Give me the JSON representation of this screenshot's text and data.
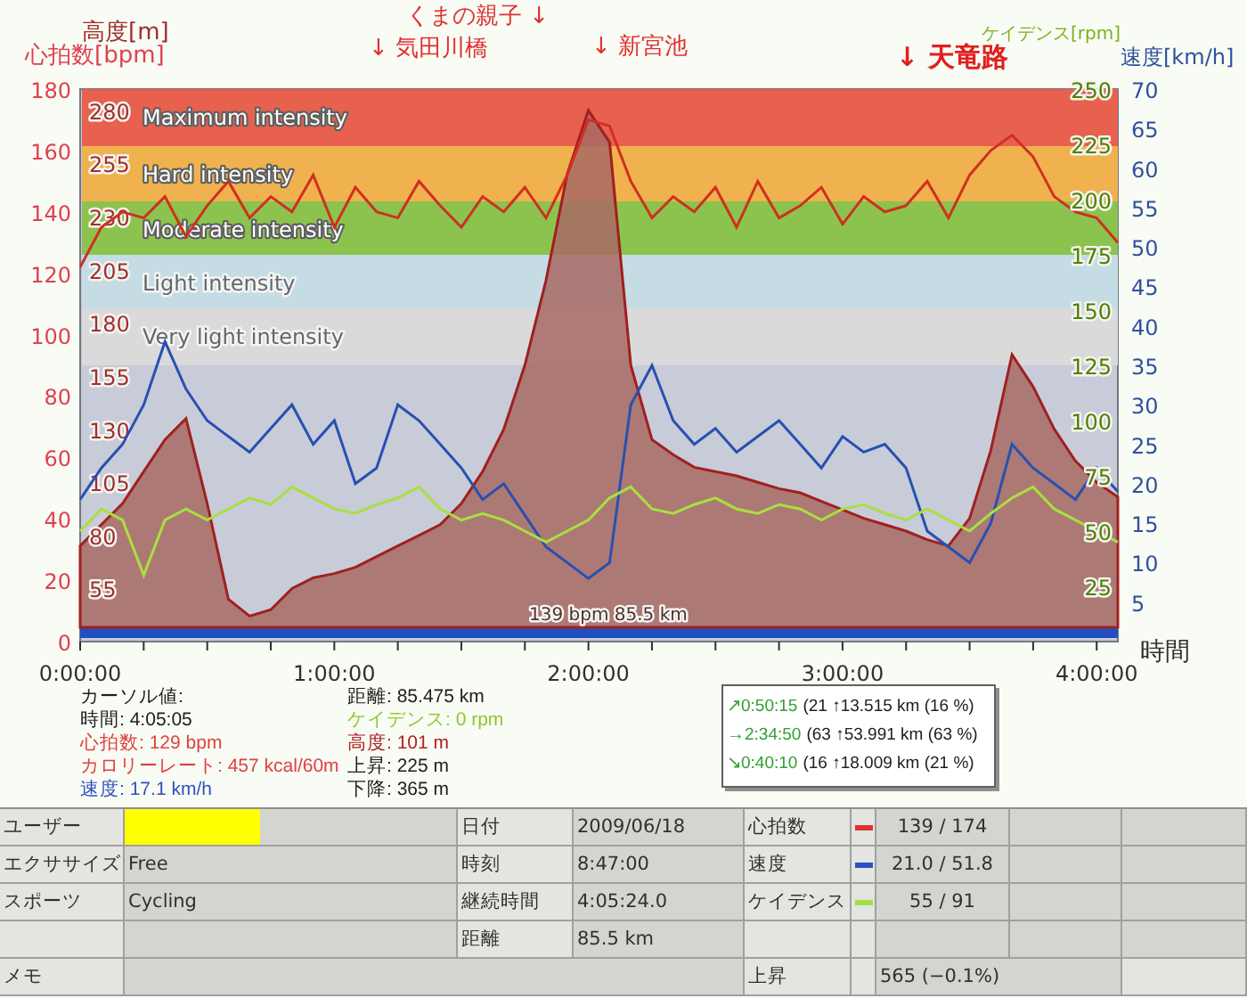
{
  "chart": {
    "markers": [
      {
        "label": "くまの親子 ↓",
        "kind": "normal"
      },
      {
        "label": "↓ 気田川橋",
        "kind": "normal"
      },
      {
        "label": "↓ 新宮池",
        "kind": "normal"
      },
      {
        "label": "↓ 天竜路",
        "kind": "bold"
      }
    ],
    "zones": [
      {
        "label": "Maximum intensity",
        "color": "#e8604e"
      },
      {
        "label": "Hard intensity",
        "color": "#f0b24e"
      },
      {
        "label": "Moderate intensity",
        "color": "#8cc34e"
      },
      {
        "label": "Light intensity",
        "color": "#c6dce4"
      },
      {
        "label": "Very light intensity",
        "color": "#dadada"
      }
    ],
    "readout": "139 bpm 85.5 km",
    "layers": [
      {
        "kind": "altitude",
        "chart_data": {
          "type": "area",
          "ylabel": "高度[m]",
          "xlim": [
            0,
            245
          ],
          "ylim": [
            30,
            290
          ],
          "yticks": [
            280,
            255,
            230,
            205,
            180,
            155,
            130,
            105,
            80,
            55
          ],
          "x": [
            0,
            5,
            10,
            15,
            20,
            25,
            30,
            35,
            40,
            45,
            50,
            55,
            60,
            65,
            70,
            75,
            80,
            85,
            90,
            95,
            100,
            105,
            110,
            115,
            120,
            125,
            130,
            135,
            140,
            145,
            150,
            155,
            160,
            165,
            170,
            175,
            180,
            185,
            190,
            195,
            200,
            205,
            210,
            215,
            220,
            225,
            230,
            235,
            240,
            245
          ],
          "values": [
            75,
            85,
            95,
            110,
            125,
            135,
            95,
            50,
            42,
            45,
            55,
            60,
            62,
            65,
            70,
            75,
            80,
            85,
            95,
            110,
            130,
            160,
            200,
            250,
            280,
            265,
            160,
            125,
            118,
            112,
            110,
            108,
            105,
            102,
            100,
            96,
            92,
            88,
            85,
            82,
            78,
            75,
            88,
            120,
            165,
            150,
            130,
            115,
            105,
            98
          ]
        }
      },
      {
        "kind": "speed",
        "chart_data": {
          "type": "line",
          "ylabel": "速度[km/h]",
          "xlim": [
            0,
            245
          ],
          "ylim": [
            0,
            70
          ],
          "yticks": [
            70,
            65,
            60,
            55,
            50,
            45,
            40,
            35,
            30,
            25,
            20,
            15,
            10,
            5
          ],
          "x": [
            0,
            5,
            10,
            15,
            20,
            25,
            30,
            35,
            40,
            45,
            50,
            55,
            60,
            65,
            70,
            75,
            80,
            85,
            90,
            95,
            100,
            105,
            110,
            115,
            120,
            125,
            130,
            135,
            140,
            145,
            150,
            155,
            160,
            165,
            170,
            175,
            180,
            185,
            190,
            195,
            200,
            205,
            210,
            215,
            220,
            225,
            230,
            235,
            240,
            245
          ],
          "values": [
            18,
            22,
            25,
            30,
            38,
            32,
            28,
            26,
            24,
            27,
            30,
            25,
            28,
            20,
            22,
            30,
            28,
            25,
            22,
            18,
            20,
            16,
            12,
            10,
            8,
            10,
            30,
            35,
            28,
            25,
            27,
            24,
            26,
            28,
            25,
            22,
            26,
            24,
            25,
            22,
            14,
            12,
            10,
            15,
            25,
            22,
            20,
            18,
            22,
            19
          ]
        }
      },
      {
        "kind": "heart_rate",
        "chart_data": {
          "type": "line",
          "xlabel": "時間",
          "ylabel": "心拍数[bpm]",
          "xlim": [
            0,
            245
          ],
          "ylim": [
            0,
            180
          ],
          "yticks": [
            180,
            160,
            140,
            120,
            100,
            80,
            60,
            40,
            20,
            0
          ],
          "xticks": [
            {
              "value": 0,
              "label": "0:00:00"
            },
            {
              "value": 60,
              "label": "1:00:00"
            },
            {
              "value": 120,
              "label": "2:00:00"
            },
            {
              "value": 180,
              "label": "3:00:00"
            },
            {
              "value": 240,
              "label": "4:00:00"
            }
          ],
          "x": [
            0,
            5,
            10,
            15,
            20,
            25,
            30,
            35,
            40,
            45,
            50,
            55,
            60,
            65,
            70,
            75,
            80,
            85,
            90,
            95,
            100,
            105,
            110,
            115,
            120,
            125,
            130,
            135,
            140,
            145,
            150,
            155,
            160,
            165,
            170,
            175,
            180,
            185,
            190,
            195,
            200,
            205,
            210,
            215,
            220,
            225,
            230,
            235,
            240,
            245
          ],
          "values": [
            122,
            135,
            140,
            138,
            145,
            132,
            142,
            150,
            138,
            145,
            140,
            152,
            135,
            148,
            140,
            138,
            150,
            142,
            135,
            145,
            140,
            148,
            138,
            152,
            170,
            168,
            150,
            138,
            145,
            140,
            148,
            135,
            150,
            138,
            142,
            148,
            136,
            145,
            140,
            142,
            150,
            138,
            152,
            160,
            165,
            158,
            145,
            140,
            138,
            130
          ]
        }
      },
      {
        "kind": "cadence",
        "chart_data": {
          "type": "line",
          "ylabel": "ケイデンス[rpm]",
          "xlim": [
            0,
            245
          ],
          "ylim": [
            0,
            250
          ],
          "yticks": [
            250,
            225,
            200,
            175,
            150,
            125,
            100,
            75,
            50,
            25
          ],
          "x": [
            0,
            5,
            10,
            15,
            20,
            25,
            30,
            35,
            40,
            45,
            50,
            55,
            60,
            65,
            70,
            75,
            80,
            85,
            90,
            95,
            100,
            105,
            110,
            115,
            120,
            125,
            130,
            135,
            140,
            145,
            150,
            155,
            160,
            165,
            170,
            175,
            180,
            185,
            190,
            195,
            200,
            205,
            210,
            215,
            220,
            225,
            230,
            235,
            240,
            245
          ],
          "values": [
            50,
            60,
            55,
            30,
            55,
            60,
            55,
            60,
            65,
            62,
            70,
            65,
            60,
            58,
            62,
            65,
            70,
            60,
            55,
            58,
            55,
            50,
            45,
            50,
            55,
            65,
            70,
            60,
            58,
            62,
            65,
            60,
            58,
            62,
            60,
            55,
            60,
            62,
            58,
            55,
            60,
            55,
            50,
            58,
            65,
            70,
            60,
            55,
            50,
            45
          ]
        }
      }
    ]
  },
  "cursor": {
    "title": "カーソル値:",
    "left": [
      {
        "label": "時間:",
        "value": "4:05:05",
        "color": "#202020"
      },
      {
        "label": "心拍数:",
        "value": "129 bpm",
        "color": "#e04040"
      },
      {
        "label": "カロリーレート:",
        "value": "457 kcal/60m",
        "color": "#e04040"
      },
      {
        "label": "速度:",
        "value": "17.1 km/h",
        "color": "#3050c0"
      }
    ],
    "right": [
      {
        "label": "距離:",
        "value": "85.475 km",
        "color": "#202020"
      },
      {
        "label": "ケイデンス:",
        "value": "0 rpm",
        "color": "#90c830"
      },
      {
        "label": "高度:",
        "value": "101 m",
        "color": "#b02020"
      },
      {
        "label": "上昇:",
        "value": "225 m",
        "color": "#202020"
      },
      {
        "label": "下降:",
        "value": "365 m",
        "color": "#202020"
      }
    ]
  },
  "laps": [
    {
      "arrow": "↗",
      "time": "0:50:15",
      "rest": "(21 ↑13.515 km (16 %)"
    },
    {
      "arrow": "→",
      "time": "2:34:50",
      "rest": "(63 ↑53.991 km (63 %)"
    },
    {
      "arrow": "↘",
      "time": "0:40:10",
      "rest": "(16 ↑18.009 km (21 %)"
    }
  ],
  "summary": [
    {
      "kind": "field",
      "label": "ユーザー",
      "redacted": true,
      "label2": "日付",
      "value2": "2009/06/18",
      "label3": "心拍数",
      "color": "#e03030",
      "value3": "139 / 174"
    },
    {
      "kind": "field",
      "label": "エクササイズ",
      "value": "Free",
      "label2": "時刻",
      "value2": "8:47:00",
      "label3": "速度",
      "color": "#3050c0",
      "value3": "21.0 / 51.8"
    },
    {
      "kind": "field",
      "label": "スポーツ",
      "value": "Cycling",
      "label2": "継続時間",
      "value2": "4:05:24.0",
      "label3": "ケイデンス",
      "color": "#a0e040",
      "value3": "55 / 91"
    },
    {
      "kind": "field",
      "label2": "距離",
      "value2": "85.5 km"
    },
    {
      "kind": "memo",
      "label": "メモ",
      "label3": "上昇",
      "value3": "565 (−0.1%)"
    }
  ]
}
